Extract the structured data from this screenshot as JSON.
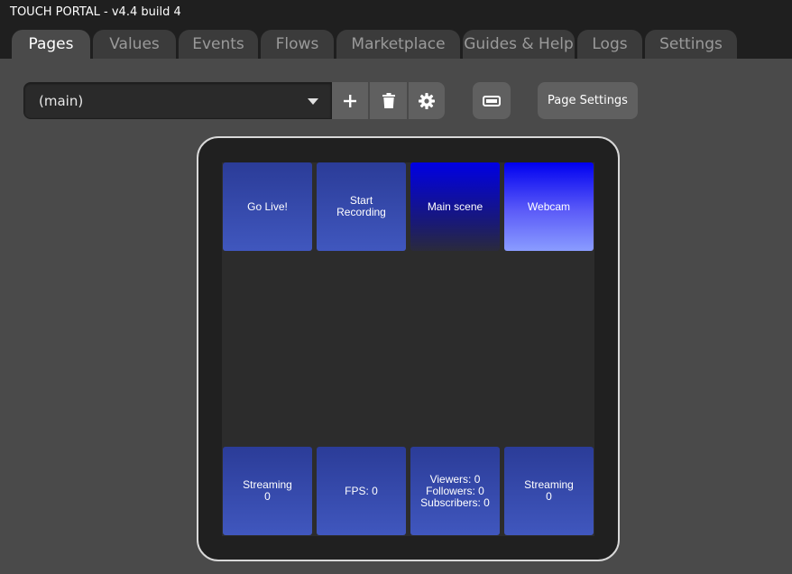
{
  "app": {
    "title": "TOUCH PORTAL - v4.4 build 4"
  },
  "tabs": [
    {
      "label": "Pages",
      "active": true
    },
    {
      "label": "Values",
      "active": false
    },
    {
      "label": "Events",
      "active": false
    },
    {
      "label": "Flows",
      "active": false
    },
    {
      "label": "Marketplace",
      "active": false
    },
    {
      "label": "Guides & Help",
      "active": false
    },
    {
      "label": "Logs",
      "active": false
    },
    {
      "label": "Settings",
      "active": false
    }
  ],
  "toolbar": {
    "page_select_value": "(main)",
    "add_icon": "plus-icon",
    "delete_icon": "trash-icon",
    "settings_icon": "gear-icon",
    "orientation_icon": "device-frame-icon",
    "page_settings_label": "Page Settings"
  },
  "buttons": {
    "top": [
      {
        "label": "Go Live!",
        "style": "gradient-blue"
      },
      {
        "label": "Start\nRecording",
        "style": "gradient-blue"
      },
      {
        "label": "Main scene",
        "style": "gradient-blue-dark"
      },
      {
        "label": "Webcam",
        "style": "gradient-blue-light"
      }
    ],
    "bottom": [
      {
        "label": "Streaming\n0",
        "style": "gradient-blue"
      },
      {
        "label": "FPS: 0",
        "style": "gradient-blue"
      },
      {
        "label": "Viewers: 0\nFollowers: 0\nSubscribers: 0",
        "style": "gradient-blue"
      },
      {
        "label": "Streaming\n0",
        "style": "gradient-blue"
      }
    ]
  },
  "colors": {
    "background": "#4a4a4a",
    "titlebar": "#1f1f1f",
    "button_blue_top": "#2b3c98",
    "button_blue_bottom": "#4057be"
  }
}
